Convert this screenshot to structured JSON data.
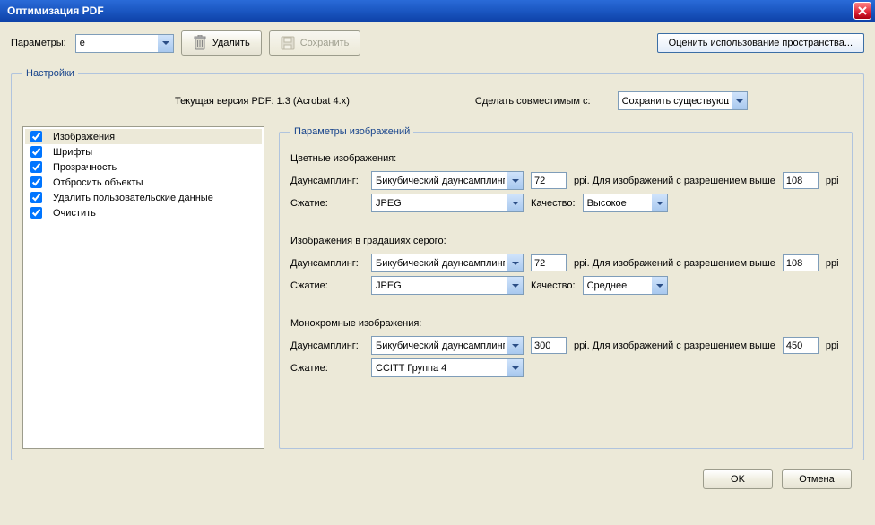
{
  "window": {
    "title": "Оптимизация PDF"
  },
  "toolbar": {
    "params_label": "Параметры:",
    "params_value": "e",
    "delete_label": "Удалить",
    "save_label": "Сохранить",
    "space_button": "Оценить использование пространства..."
  },
  "settings": {
    "legend": "Настройки",
    "version_label": "Текущая версия PDF: 1.3 (Acrobat 4.x)",
    "compat_label": "Сделать совместимым с:",
    "compat_value": "Сохранить существующую",
    "sidebar": [
      {
        "label": "Изображения",
        "checked": true,
        "selected": true
      },
      {
        "label": "Шрифты",
        "checked": true,
        "selected": false
      },
      {
        "label": "Прозрачность",
        "checked": true,
        "selected": false
      },
      {
        "label": "Отбросить объекты",
        "checked": true,
        "selected": false
      },
      {
        "label": "Удалить пользовательские данные",
        "checked": true,
        "selected": false
      },
      {
        "label": "Очистить",
        "checked": true,
        "selected": false
      }
    ],
    "panel": {
      "legend": "Параметры изображений",
      "groups": [
        {
          "title": "Цветные изображения:",
          "downsample_label": "Даунсамплинг:",
          "downsample_value": "Бикубический даунсамплинг",
          "dpi": "72",
          "ppi_label": "ppi. Для изображений с разрешением выше",
          "above": "108",
          "ppi2": "ppi",
          "compress_label": "Сжатие:",
          "compress_value": "JPEG",
          "quality_label": "Качество:",
          "quality_value": "Высокое"
        },
        {
          "title": "Изображения в градациях серого:",
          "downsample_label": "Даунсамплинг:",
          "downsample_value": "Бикубический даунсамплинг",
          "dpi": "72",
          "ppi_label": "ppi. Для изображений с разрешением выше",
          "above": "108",
          "ppi2": "ppi",
          "compress_label": "Сжатие:",
          "compress_value": "JPEG",
          "quality_label": "Качество:",
          "quality_value": "Среднее"
        },
        {
          "title": "Монохромные изображения:",
          "downsample_label": "Даунсамплинг:",
          "downsample_value": "Бикубический даунсамплинг",
          "dpi": "300",
          "ppi_label": "ppi. Для изображений с разрешением выше",
          "above": "450",
          "ppi2": "ppi",
          "compress_label": "Сжатие:",
          "compress_value": "CCITT Группа 4",
          "quality_label": "",
          "quality_value": ""
        }
      ]
    }
  },
  "footer": {
    "ok": "OK",
    "cancel": "Отмена"
  }
}
